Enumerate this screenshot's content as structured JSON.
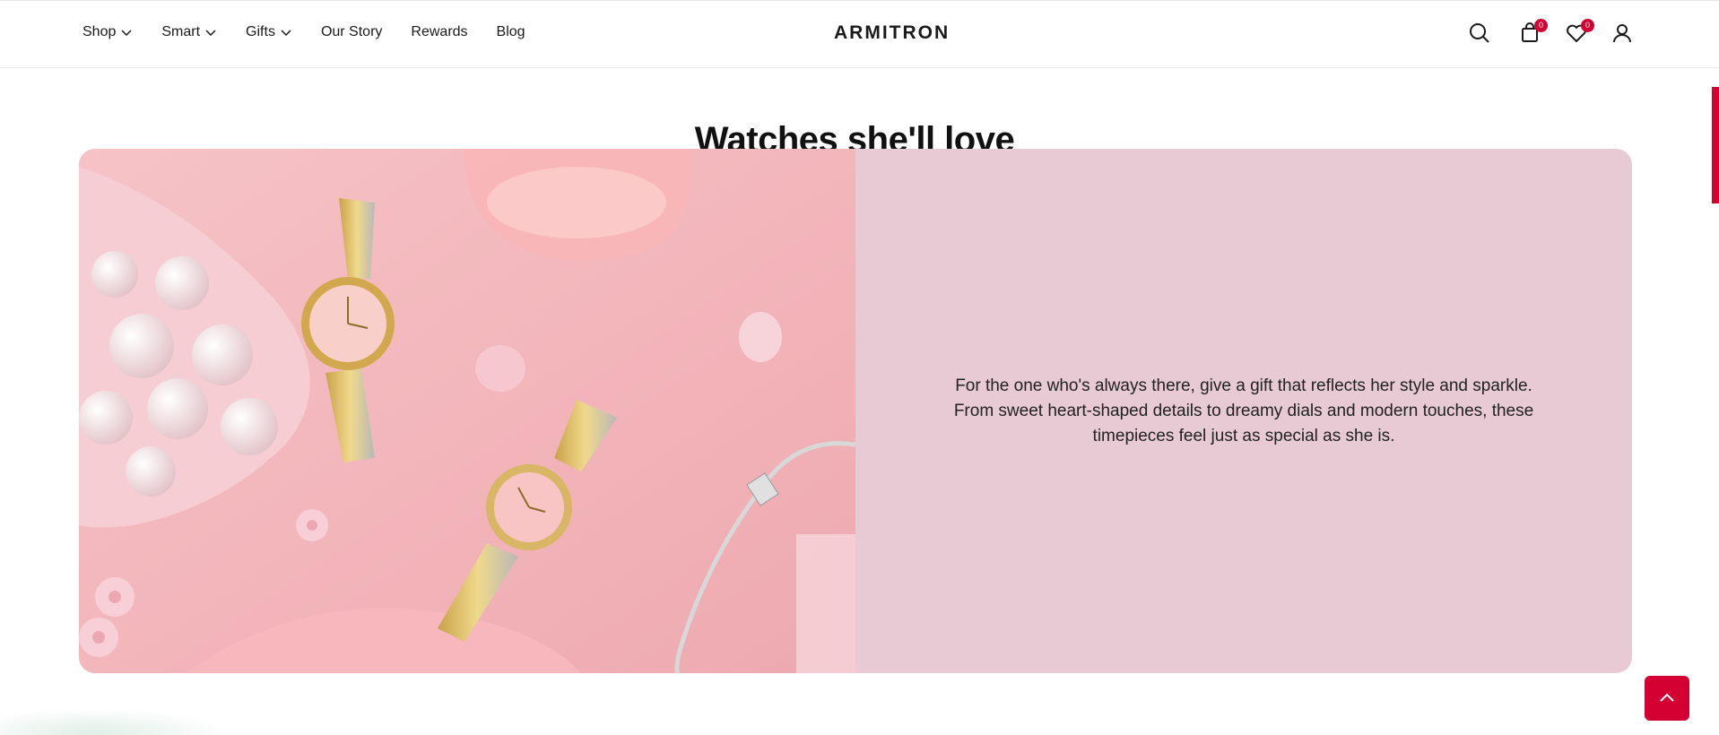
{
  "header": {
    "nav": [
      {
        "label": "Shop",
        "has_dropdown": true
      },
      {
        "label": "Smart",
        "has_dropdown": true
      },
      {
        "label": "Gifts",
        "has_dropdown": true
      },
      {
        "label": "Our Story",
        "has_dropdown": false
      },
      {
        "label": "Rewards",
        "has_dropdown": false
      },
      {
        "label": "Blog",
        "has_dropdown": false
      }
    ],
    "brand": "ARMITRON",
    "icons": [
      "search-icon",
      "shopping-bag-icon",
      "heart-icon",
      "user-icon"
    ],
    "cart_count": "0",
    "wishlist_count": "0"
  },
  "section": {
    "title": "Watches she'll love",
    "body": "For the one who's always there, give a gift that reflects her style and sparkle. From sweet heart-shaped details to dreamy dials and modern touches, these timepieces feel just as special as she is."
  },
  "colors": {
    "accent": "#d50032",
    "panel": "#e8cad5",
    "photo_bg": "#f2b9bf"
  },
  "back_to_top_icon": "chevron-up-icon"
}
